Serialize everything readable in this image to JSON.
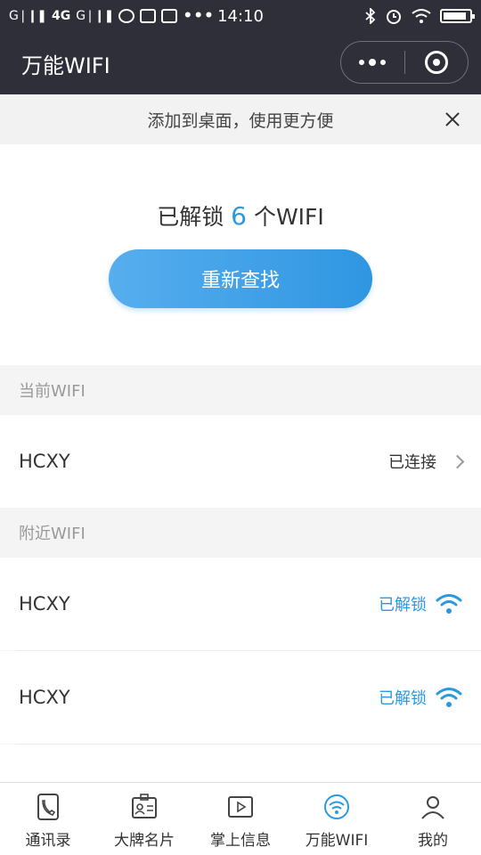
{
  "statusbar": {
    "signal": "G❘❙❚",
    "network": "4G",
    "signal2": "G❘❙❚",
    "dots": "•••",
    "time": "14:10",
    "battery_level": 0.9
  },
  "navbar": {
    "title": "万能WIFI"
  },
  "banner": {
    "text": "添加到桌面，使用更方便"
  },
  "hero": {
    "prefix": "已解锁",
    "count": "6",
    "suffix": "个WIFI",
    "button_label": "重新查找",
    "accent_color": "#2a9ae0"
  },
  "current": {
    "header": "当前WIFI",
    "ssid": "HCXY",
    "status": "已连接"
  },
  "nearby": {
    "header": "附近WIFI",
    "items": [
      {
        "ssid": "HCXY",
        "status": "已解锁"
      },
      {
        "ssid": "HCXY",
        "status": "已解锁"
      }
    ]
  },
  "tabbar": {
    "tabs": [
      {
        "label": "通讯录",
        "icon": "phone-book-icon"
      },
      {
        "label": "大牌名片",
        "icon": "id-card-icon"
      },
      {
        "label": "掌上信息",
        "icon": "video-icon"
      },
      {
        "label": "万能WIFI",
        "icon": "wifi-icon"
      },
      {
        "label": "我的",
        "icon": "user-icon"
      }
    ]
  }
}
